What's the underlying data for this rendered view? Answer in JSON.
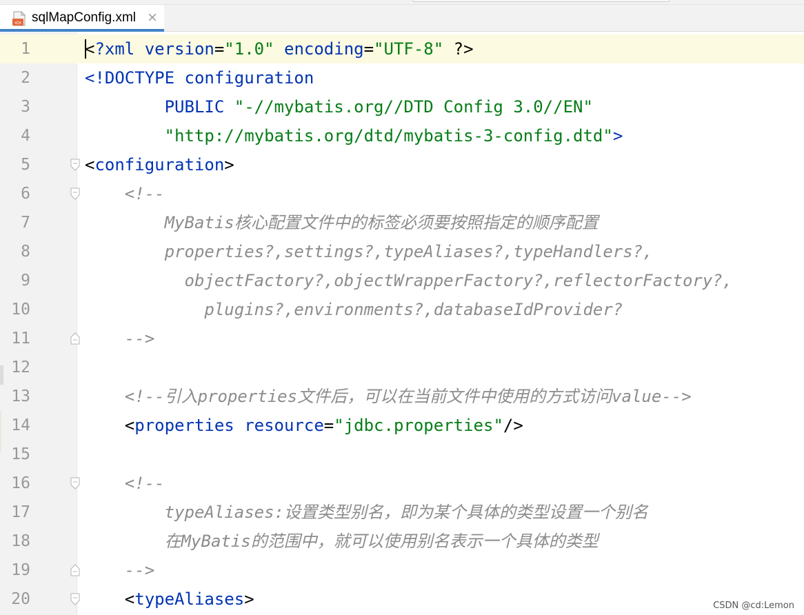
{
  "colors": {
    "tag": "#0033b3",
    "string": "#067d17",
    "comment": "#8c8c8c",
    "plain": "#000000",
    "gutter": "#f2f2f2",
    "tab_accent": "#4083c9",
    "current_line": "#fcfae0"
  },
  "tab": {
    "title": "sqlMapConfig.xml",
    "close": "×",
    "icon": "xml-file-icon"
  },
  "lines": [
    {
      "n": "1",
      "fold": "",
      "segs": [
        [
          "bk",
          "<"
        ],
        [
          "bl",
          "?xml version"
        ],
        [
          "bk",
          "="
        ],
        [
          "gr",
          "\"1.0\""
        ],
        [
          "bl",
          " encoding"
        ],
        [
          "bk",
          "="
        ],
        [
          "gr",
          "\"UTF-8\""
        ],
        [
          "bk",
          " ?>"
        ]
      ]
    },
    {
      "n": "2",
      "fold": "",
      "segs": [
        [
          "bl",
          "<!DOCTYPE configuration"
        ]
      ]
    },
    {
      "n": "3",
      "fold": "",
      "segs": [
        [
          "bl",
          "        PUBLIC "
        ],
        [
          "gr",
          "\"-//mybatis.org//DTD Config 3.0//EN\""
        ]
      ]
    },
    {
      "n": "4",
      "fold": "",
      "segs": [
        [
          "gr",
          "        \"http://mybatis.org/dtd/mybatis-3-config.dtd\""
        ],
        [
          "bl",
          ">"
        ]
      ]
    },
    {
      "n": "5",
      "fold": "open",
      "segs": [
        [
          "bk",
          "<"
        ],
        [
          "bl",
          "configuration"
        ],
        [
          "bk",
          ">"
        ]
      ]
    },
    {
      "n": "6",
      "fold": "open",
      "segs": [
        [
          "cm",
          "    <!--"
        ]
      ]
    },
    {
      "n": "7",
      "fold": "",
      "segs": [
        [
          "cm",
          "        MyBatis核心配置文件中的标签必须要按照指定的顺序配置"
        ]
      ]
    },
    {
      "n": "8",
      "fold": "",
      "segs": [
        [
          "cm",
          "        properties?,settings?,typeAliases?,typeHandlers?,"
        ]
      ]
    },
    {
      "n": "9",
      "fold": "",
      "segs": [
        [
          "cm",
          "          objectFactory?,objectWrapperFactory?,reflectorFactory?,"
        ]
      ]
    },
    {
      "n": "10",
      "fold": "",
      "segs": [
        [
          "cm",
          "            plugins?,environments?,databaseIdProvider?"
        ]
      ]
    },
    {
      "n": "11",
      "fold": "close",
      "segs": [
        [
          "cm",
          "    -->"
        ]
      ]
    },
    {
      "n": "12",
      "fold": "",
      "segs": []
    },
    {
      "n": "13",
      "fold": "",
      "segs": [
        [
          "cm",
          "    <!--引入properties文件后，可以在当前文件中使用的方式访问value-->"
        ]
      ]
    },
    {
      "n": "14",
      "fold": "",
      "segs": [
        [
          "bk",
          "    <"
        ],
        [
          "bl",
          "properties"
        ],
        [
          "bl",
          " resource"
        ],
        [
          "bk",
          "="
        ],
        [
          "gr",
          "\"jdbc.properties\""
        ],
        [
          "bk",
          "/>"
        ]
      ]
    },
    {
      "n": "15",
      "fold": "",
      "segs": []
    },
    {
      "n": "16",
      "fold": "open",
      "segs": [
        [
          "cm",
          "    <!--"
        ]
      ]
    },
    {
      "n": "17",
      "fold": "",
      "segs": [
        [
          "cm",
          "        typeAliases:设置类型别名，即为某个具体的类型设置一个别名"
        ]
      ]
    },
    {
      "n": "18",
      "fold": "",
      "segs": [
        [
          "cm",
          "        在MyBatis的范围中，就可以使用别名表示一个具体的类型"
        ]
      ]
    },
    {
      "n": "19",
      "fold": "close",
      "segs": [
        [
          "cm",
          "    -->"
        ]
      ]
    },
    {
      "n": "20",
      "fold": "open",
      "segs": [
        [
          "bk",
          "    <"
        ],
        [
          "bl",
          "typeAliases"
        ],
        [
          "bk",
          ">"
        ]
      ]
    }
  ],
  "watermark": "CSDN @cd:Lemon"
}
